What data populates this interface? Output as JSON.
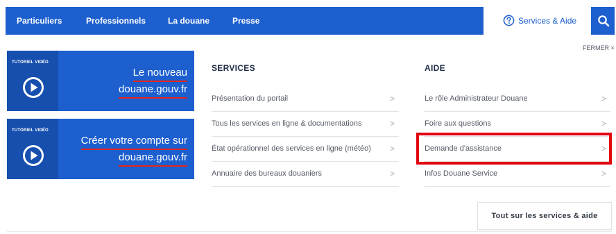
{
  "nav": {
    "items": [
      {
        "label": "Particuliers"
      },
      {
        "label": "Professionnels"
      },
      {
        "label": "La douane"
      },
      {
        "label": "Presse"
      }
    ],
    "services_aide_label": "Services & Aide",
    "services_aide_icon": "question-circle-icon",
    "search_icon": "search-icon"
  },
  "close": {
    "label": "FERMER ×"
  },
  "tiles": [
    {
      "tag": "TUTORIEL VIDÉO",
      "line1": "Le nouveau",
      "line2": "douane.gouv.fr",
      "icon": "play-circle-icon"
    },
    {
      "tag": "TUTORIEL VIDÉO",
      "line1": "Créer votre compte sur",
      "line2": "douane.gouv.fr",
      "icon": "play-circle-icon"
    }
  ],
  "services": {
    "title": "SERVICES",
    "links": [
      {
        "label": "Présentation du portail",
        "chevron": ">"
      },
      {
        "label": "Tous les services en ligne & documentations",
        "chevron": ">"
      },
      {
        "label": "État opérationnel des services en ligne (météo)",
        "chevron": ">"
      },
      {
        "label": "Annuaire des bureaux douaniers",
        "chevron": ">"
      }
    ]
  },
  "aide": {
    "title": "AIDE",
    "links": [
      {
        "label": "Le rôle Administrateur Douane",
        "chevron": ">"
      },
      {
        "label": "Foire aux questions",
        "chevron": ">"
      },
      {
        "label": "Demande d'assistance",
        "chevron": ">"
      },
      {
        "label": "Infos Douane Service",
        "chevron": ">"
      }
    ]
  },
  "cta": {
    "label": "Tout sur les services & aide"
  },
  "colors": {
    "brand_blue": "#1d5fcf",
    "tile_dark_blue": "#164fae",
    "highlight_red": "#e20613",
    "underline_red": "#e2261c"
  }
}
